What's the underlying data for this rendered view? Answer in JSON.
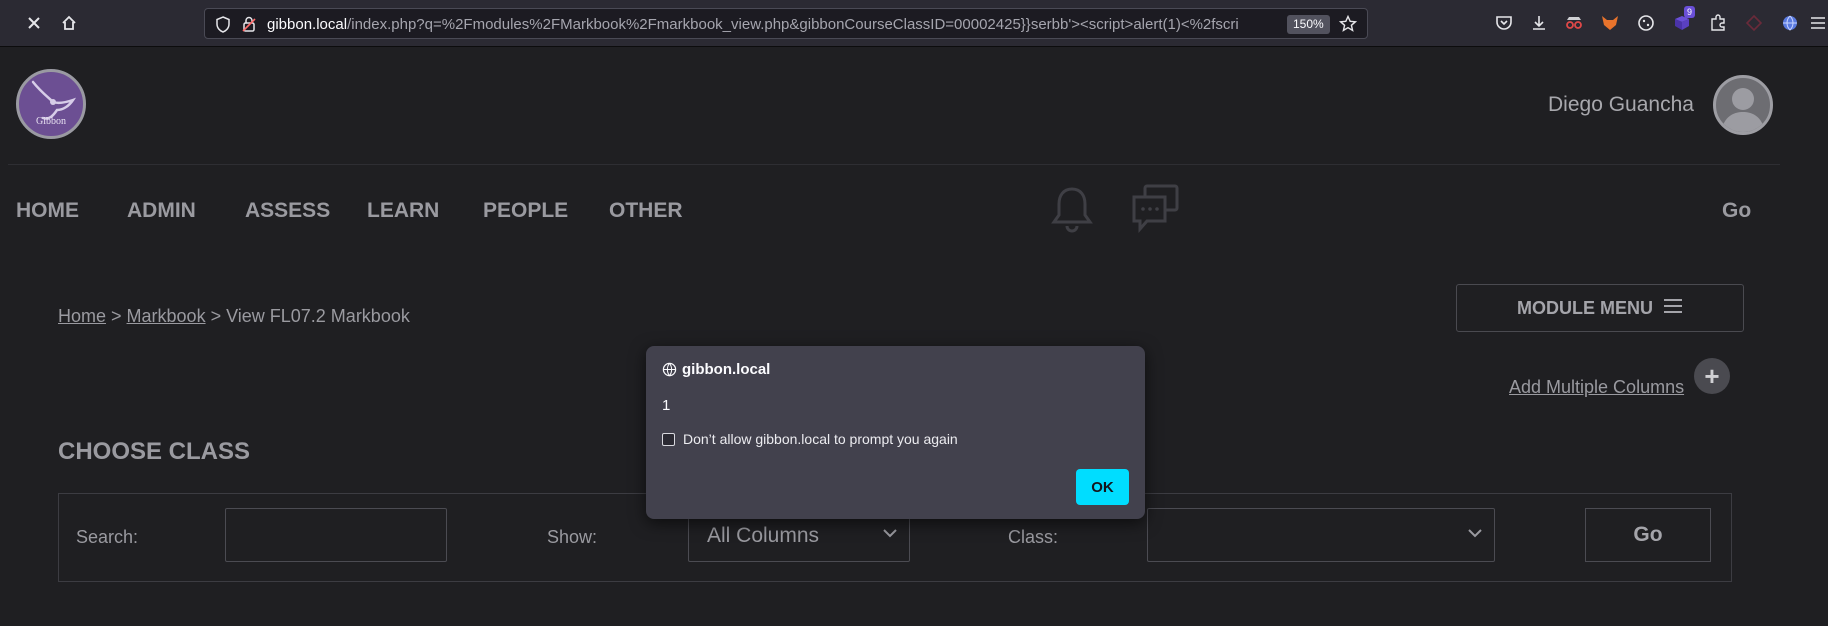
{
  "browser": {
    "url_host": "gibbon.local",
    "url_path": "/index.php?q=%2Fmodules%2FMarkbook%2Fmarkbook_view.php&gibbonCourseClassID=00002425}}serbb'><script>alert(1)<%2fscri",
    "zoom": "150%",
    "extension_badge": "9",
    "colors": {
      "toolbar": "#2b2a33",
      "urlbar": "#1c1b22"
    }
  },
  "header": {
    "logo_text": "Gibbon",
    "user_name": "Diego Guancha"
  },
  "nav": {
    "items": [
      "HOME",
      "ADMIN",
      "ASSESS",
      "LEARN",
      "PEOPLE",
      "OTHER"
    ],
    "go_label": "Go"
  },
  "breadcrumb": {
    "home": "Home",
    "sep1": " > ",
    "markbook": "Markbook",
    "sep2": " > ",
    "current": "View FL07.2 Markbook"
  },
  "module_menu_label": "MODULE MENU",
  "add_columns_label": "Add Multiple Columns",
  "choose_class": {
    "title": "CHOOSE CLASS",
    "search_label": "Search:",
    "search_value": "",
    "show_label": "Show:",
    "show_value": "All Columns",
    "class_label": "Class:",
    "class_value": "",
    "go_label": "Go"
  },
  "dialog": {
    "origin": "gibbon.local",
    "message": "1",
    "checkbox_label": "Don’t allow gibbon.local to prompt you again",
    "ok_label": "OK",
    "accent": "#00ddff"
  }
}
